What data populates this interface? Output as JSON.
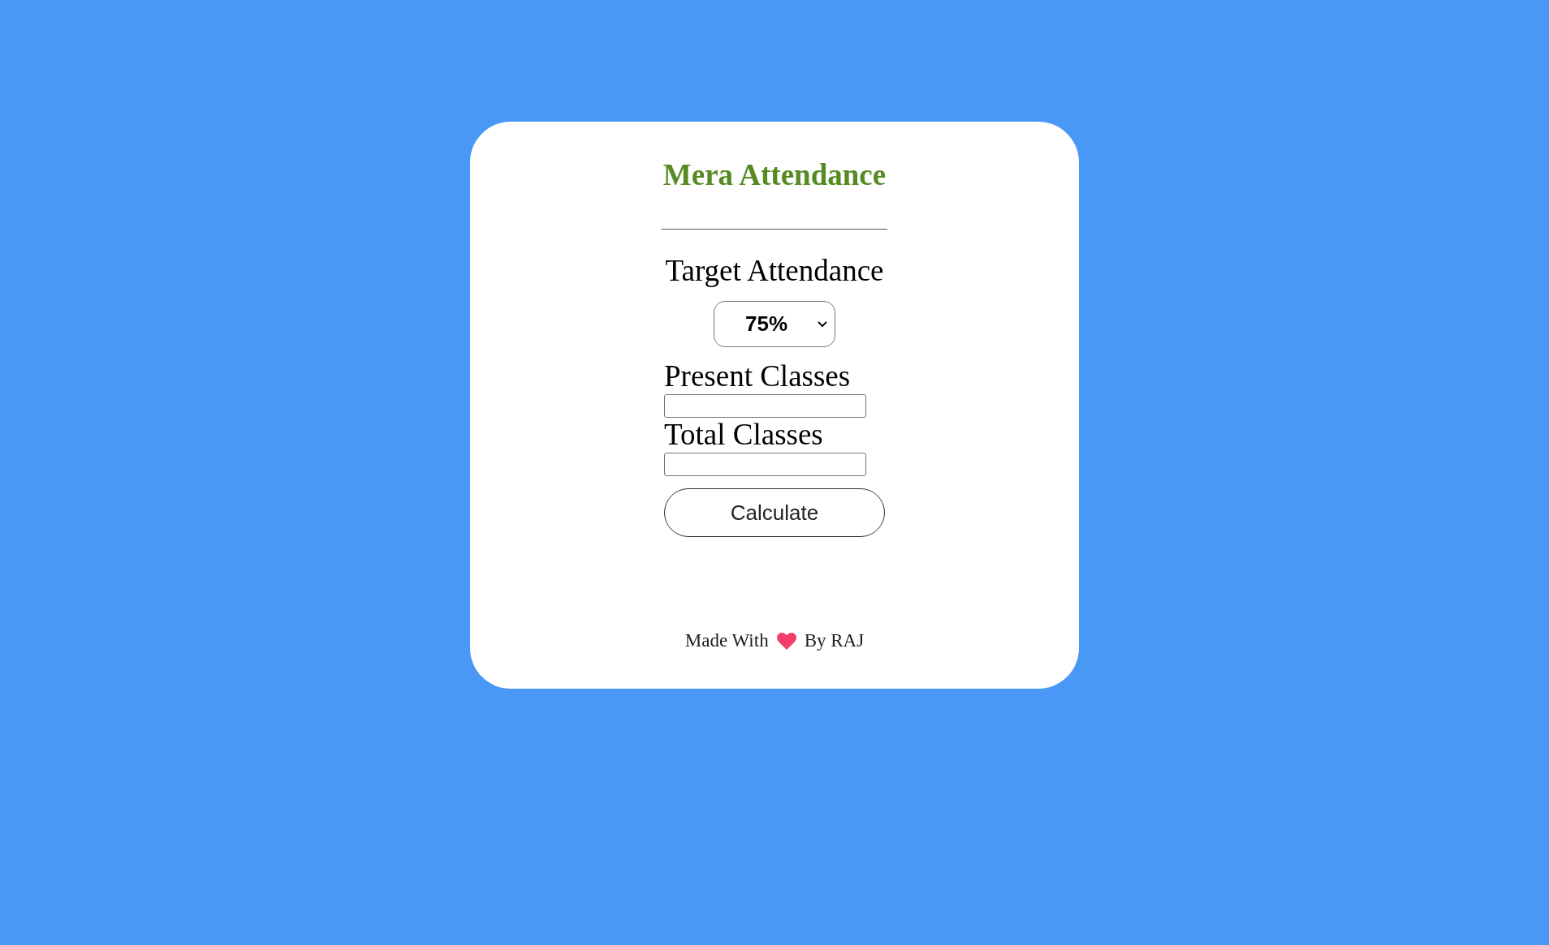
{
  "title": "Mera Attendance",
  "target_attendance": {
    "label": "Target Attendance",
    "value": "75%"
  },
  "fields": [
    {
      "label": "Present Classes"
    },
    {
      "label": "Total Classes"
    }
  ],
  "button": {
    "label": "Calculate"
  },
  "footer": {
    "text_before": "Made With",
    "text_after": "By RAJ"
  }
}
